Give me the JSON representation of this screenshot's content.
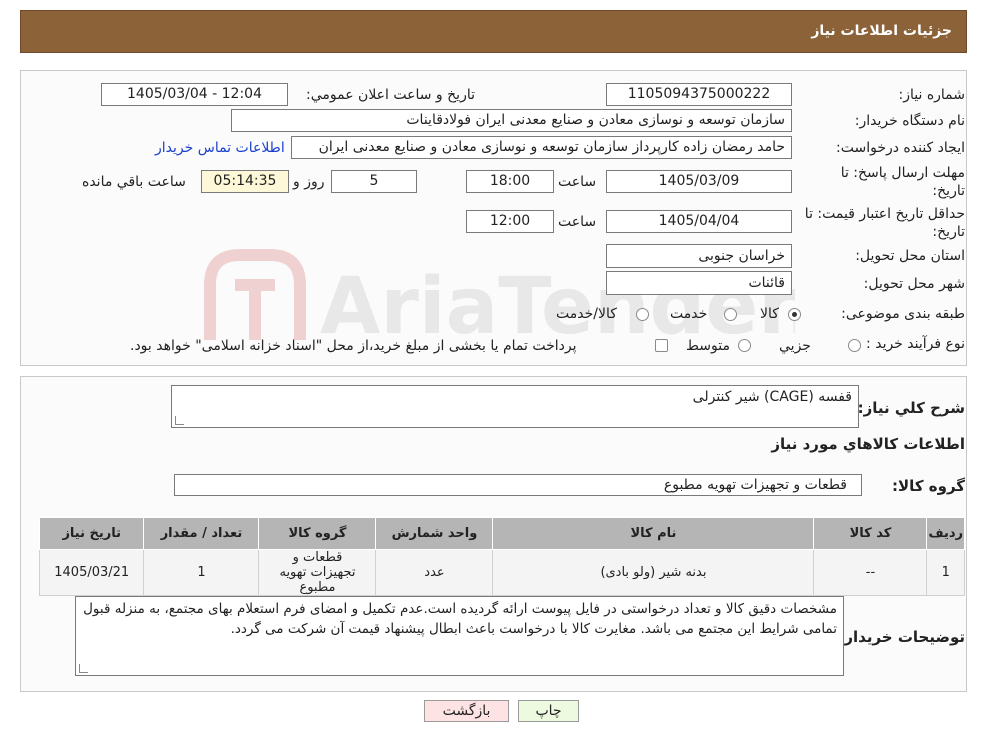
{
  "header": {
    "title": "جزئیات اطلاعات نیاز"
  },
  "watermark": {
    "text": "AriaTender.neT"
  },
  "form": {
    "need_number_label": "شماره نیاز:",
    "need_number": "1105094375000222",
    "announce_label": "تاریخ و ساعت اعلان عمومي:",
    "announce_value": "1405/03/04 - 12:04",
    "buyer_org_label": "نام دستگاه خريدار:",
    "buyer_org": "سازمان توسعه و نوسازی معادن و صنایع معدنی ایران فولادقاینات",
    "creator_label": "ايجاد كننده درخواست:",
    "creator": "حامد  رمضان زاده  کارپرداز  سازمان توسعه و نوسازی معادن و صنایع معدنی ایران",
    "contact_link": "اطلاعات تماس خريدار",
    "deadline_label_1": "مهلت ارسال پاسخ: تا",
    "deadline_label_2": "تاريخ:",
    "deadline_date": "1405/03/09",
    "time_word": "ساعت",
    "deadline_time": "18:00",
    "days_value": "5",
    "days_word": "روز و",
    "remaining_time": "05:14:35",
    "remaining_word": "ساعت باقي مانده",
    "validity_label_1": "حداقل تاريخ اعتبار قيمت: تا",
    "validity_label_2": "تاريخ:",
    "validity_date": "1405/04/04",
    "validity_time": "12:00",
    "province_label": "استان محل تحويل:",
    "province": "خراسان جنوبی",
    "city_label": "شهر محل تحويل:",
    "city": "قائنات",
    "category_label": "طبقه بندی موضوعی:",
    "category_options": [
      "كالا",
      "خدمت",
      "كالا/خدمت"
    ],
    "process_label": "نوع فرآيند خريد :",
    "process_options": [
      "جزيي",
      "متوسط"
    ],
    "process_note": "پرداخت تمام يا بخشی از مبلغ خريد،از محل \"اسناد خزانه اسلامی\" خواهد بود."
  },
  "details": {
    "summary_label": "شرح كلي نياز:",
    "summary": "قفسه (CAGE) شیر کنترلی",
    "goods_info_title": "اطلاعات كالاهاي مورد نياز",
    "goods_group_label": "گروه كالا:",
    "goods_group": "قطعات و تجهیزات تهویه مطبوع",
    "table": {
      "headers": [
        "رديف",
        "كد كالا",
        "نام كالا",
        "واحد شمارش",
        "گروه كالا",
        "تعداد / مقدار",
        "تاريخ نياز"
      ],
      "rows": [
        [
          "1",
          "--",
          "بدنه شیر (ولو بادی)",
          "عدد",
          "قطعات و تجهیزات تهویه مطبوع",
          "1",
          "1405/03/21"
        ]
      ]
    },
    "buyer_notes_label": "توضيحات خريدار:",
    "buyer_notes": "مشخصات دقیق کالا و تعداد درخواستی در فایل پیوست ارائه گردیده است.عدم تکمیل و امضای فرم استعلام بهای مجتمع، به منزله قبول تمامی شرایط این مجتمع می باشد. مغایرت کالا با درخواست باعث ابطال پیشنهاد قیمت آن شرکت می گردد."
  },
  "buttons": {
    "print": "چاپ",
    "back": "بازگشت"
  }
}
